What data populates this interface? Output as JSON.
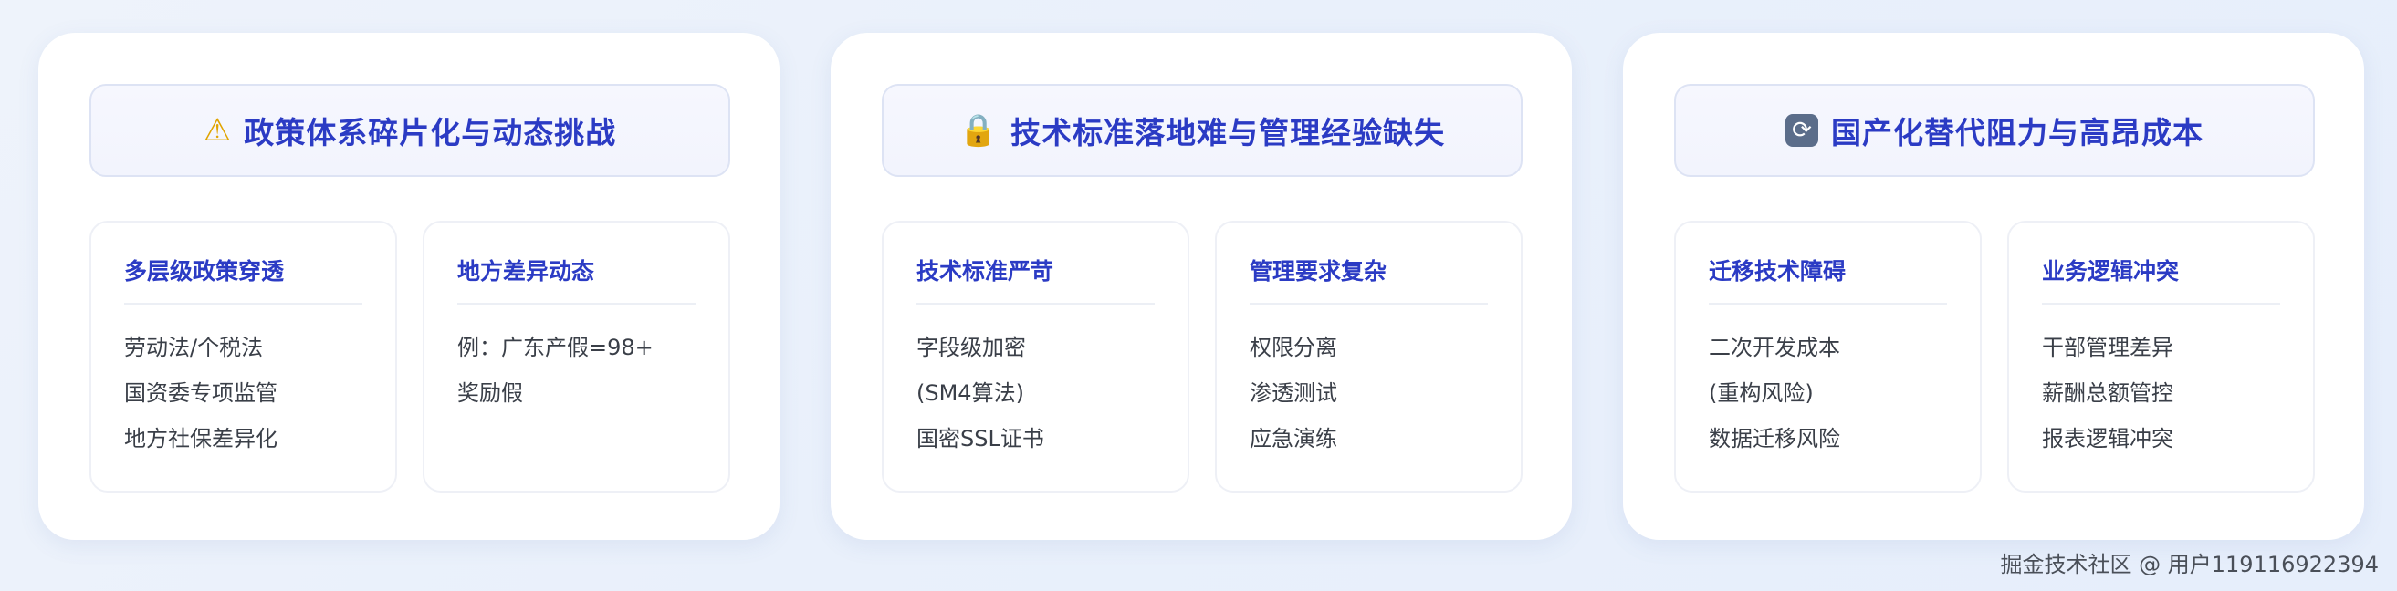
{
  "panels": [
    {
      "icon": "warning-icon",
      "icon_glyph": "⚠",
      "title": "政策体系碎片化与动态挑战",
      "cards": [
        {
          "title": "多层级政策穿透",
          "lines": [
            "劳动法/个税法",
            "国资委专项监管",
            "地方社保差异化"
          ]
        },
        {
          "title": "地方差异动态",
          "lines": [
            "例：广东产假=98+",
            "奖励假"
          ]
        }
      ]
    },
    {
      "icon": "lock-icon",
      "icon_glyph": "🔒",
      "title": "技术标准落地难与管理经验缺失",
      "cards": [
        {
          "title": "技术标准严苛",
          "lines": [
            "字段级加密",
            "(SM4算法)",
            "国密SSL证书"
          ]
        },
        {
          "title": "管理要求复杂",
          "lines": [
            "权限分离",
            "渗透测试",
            "应急演练"
          ]
        }
      ]
    },
    {
      "icon": "sync-icon",
      "icon_glyph": "⟳",
      "title": "国产化替代阻力与高昂成本",
      "cards": [
        {
          "title": "迁移技术障碍",
          "lines": [
            "二次开发成本",
            "(重构风险)",
            "数据迁移风险"
          ]
        },
        {
          "title": "业务逻辑冲突",
          "lines": [
            "干部管理差异",
            "薪酬总额管控",
            "报表逻辑冲突"
          ]
        }
      ]
    }
  ],
  "watermark": "掘金技术社区 @ 用户119116922394"
}
